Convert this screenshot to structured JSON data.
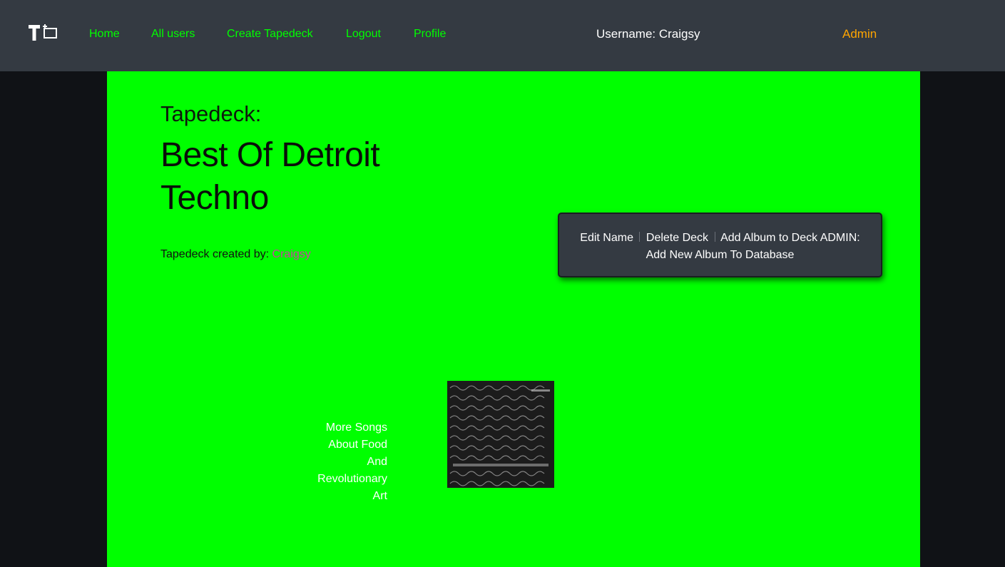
{
  "nav": {
    "logo": "logo-tapedeck-icon",
    "links": [
      "Home",
      "All users",
      "Create Tapedeck",
      "Logout",
      "Profile"
    ],
    "username_text": "Username: Craigsy",
    "admin_label": "Admin"
  },
  "colors": {
    "navbar_bg": "#343a42",
    "link_green": "#00ff00",
    "page_green": "#00ff00",
    "admin_orange": "#ffa500",
    "creator_pink": "#cc3ea0"
  },
  "deck": {
    "label": "Tapedeck:",
    "title": "Best Of Detroit Techno",
    "created_by_label": "Tapedeck created by:",
    "creator": "Craigsy"
  },
  "actions": {
    "edit_name": "Edit Name",
    "delete_deck": "Delete Deck",
    "add_album": "Add Album to Deck",
    "admin_label": "ADMIN:",
    "add_new_album": "Add New Album To Database"
  },
  "albums": [
    {
      "title": "More Songs About Food And Revolutionary Art",
      "cover_icon": "album-cover-handwriting-image"
    }
  ]
}
